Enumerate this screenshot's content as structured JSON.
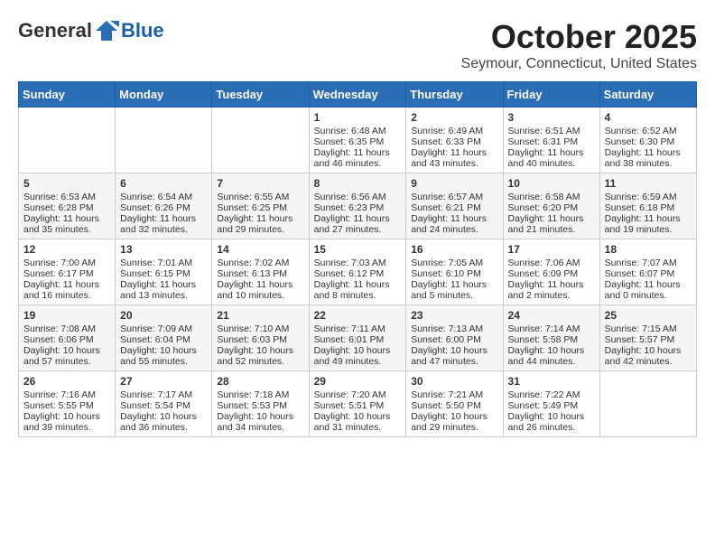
{
  "header": {
    "logo_general": "General",
    "logo_blue": "Blue",
    "month_title": "October 2025",
    "location": "Seymour, Connecticut, United States"
  },
  "weekdays": [
    "Sunday",
    "Monday",
    "Tuesday",
    "Wednesday",
    "Thursday",
    "Friday",
    "Saturday"
  ],
  "weeks": [
    [
      {
        "day": "",
        "content": ""
      },
      {
        "day": "",
        "content": ""
      },
      {
        "day": "",
        "content": ""
      },
      {
        "day": "1",
        "content": "Sunrise: 6:48 AM\nSunset: 6:35 PM\nDaylight: 11 hours and 46 minutes."
      },
      {
        "day": "2",
        "content": "Sunrise: 6:49 AM\nSunset: 6:33 PM\nDaylight: 11 hours and 43 minutes."
      },
      {
        "day": "3",
        "content": "Sunrise: 6:51 AM\nSunset: 6:31 PM\nDaylight: 11 hours and 40 minutes."
      },
      {
        "day": "4",
        "content": "Sunrise: 6:52 AM\nSunset: 6:30 PM\nDaylight: 11 hours and 38 minutes."
      }
    ],
    [
      {
        "day": "5",
        "content": "Sunrise: 6:53 AM\nSunset: 6:28 PM\nDaylight: 11 hours and 35 minutes."
      },
      {
        "day": "6",
        "content": "Sunrise: 6:54 AM\nSunset: 6:26 PM\nDaylight: 11 hours and 32 minutes."
      },
      {
        "day": "7",
        "content": "Sunrise: 6:55 AM\nSunset: 6:25 PM\nDaylight: 11 hours and 29 minutes."
      },
      {
        "day": "8",
        "content": "Sunrise: 6:56 AM\nSunset: 6:23 PM\nDaylight: 11 hours and 27 minutes."
      },
      {
        "day": "9",
        "content": "Sunrise: 6:57 AM\nSunset: 6:21 PM\nDaylight: 11 hours and 24 minutes."
      },
      {
        "day": "10",
        "content": "Sunrise: 6:58 AM\nSunset: 6:20 PM\nDaylight: 11 hours and 21 minutes."
      },
      {
        "day": "11",
        "content": "Sunrise: 6:59 AM\nSunset: 6:18 PM\nDaylight: 11 hours and 19 minutes."
      }
    ],
    [
      {
        "day": "12",
        "content": "Sunrise: 7:00 AM\nSunset: 6:17 PM\nDaylight: 11 hours and 16 minutes."
      },
      {
        "day": "13",
        "content": "Sunrise: 7:01 AM\nSunset: 6:15 PM\nDaylight: 11 hours and 13 minutes."
      },
      {
        "day": "14",
        "content": "Sunrise: 7:02 AM\nSunset: 6:13 PM\nDaylight: 11 hours and 10 minutes."
      },
      {
        "day": "15",
        "content": "Sunrise: 7:03 AM\nSunset: 6:12 PM\nDaylight: 11 hours and 8 minutes."
      },
      {
        "day": "16",
        "content": "Sunrise: 7:05 AM\nSunset: 6:10 PM\nDaylight: 11 hours and 5 minutes."
      },
      {
        "day": "17",
        "content": "Sunrise: 7:06 AM\nSunset: 6:09 PM\nDaylight: 11 hours and 2 minutes."
      },
      {
        "day": "18",
        "content": "Sunrise: 7:07 AM\nSunset: 6:07 PM\nDaylight: 11 hours and 0 minutes."
      }
    ],
    [
      {
        "day": "19",
        "content": "Sunrise: 7:08 AM\nSunset: 6:06 PM\nDaylight: 10 hours and 57 minutes."
      },
      {
        "day": "20",
        "content": "Sunrise: 7:09 AM\nSunset: 6:04 PM\nDaylight: 10 hours and 55 minutes."
      },
      {
        "day": "21",
        "content": "Sunrise: 7:10 AM\nSunset: 6:03 PM\nDaylight: 10 hours and 52 minutes."
      },
      {
        "day": "22",
        "content": "Sunrise: 7:11 AM\nSunset: 6:01 PM\nDaylight: 10 hours and 49 minutes."
      },
      {
        "day": "23",
        "content": "Sunrise: 7:13 AM\nSunset: 6:00 PM\nDaylight: 10 hours and 47 minutes."
      },
      {
        "day": "24",
        "content": "Sunrise: 7:14 AM\nSunset: 5:58 PM\nDaylight: 10 hours and 44 minutes."
      },
      {
        "day": "25",
        "content": "Sunrise: 7:15 AM\nSunset: 5:57 PM\nDaylight: 10 hours and 42 minutes."
      }
    ],
    [
      {
        "day": "26",
        "content": "Sunrise: 7:16 AM\nSunset: 5:55 PM\nDaylight: 10 hours and 39 minutes."
      },
      {
        "day": "27",
        "content": "Sunrise: 7:17 AM\nSunset: 5:54 PM\nDaylight: 10 hours and 36 minutes."
      },
      {
        "day": "28",
        "content": "Sunrise: 7:18 AM\nSunset: 5:53 PM\nDaylight: 10 hours and 34 minutes."
      },
      {
        "day": "29",
        "content": "Sunrise: 7:20 AM\nSunset: 5:51 PM\nDaylight: 10 hours and 31 minutes."
      },
      {
        "day": "30",
        "content": "Sunrise: 7:21 AM\nSunset: 5:50 PM\nDaylight: 10 hours and 29 minutes."
      },
      {
        "day": "31",
        "content": "Sunrise: 7:22 AM\nSunset: 5:49 PM\nDaylight: 10 hours and 26 minutes."
      },
      {
        "day": "",
        "content": ""
      }
    ]
  ]
}
